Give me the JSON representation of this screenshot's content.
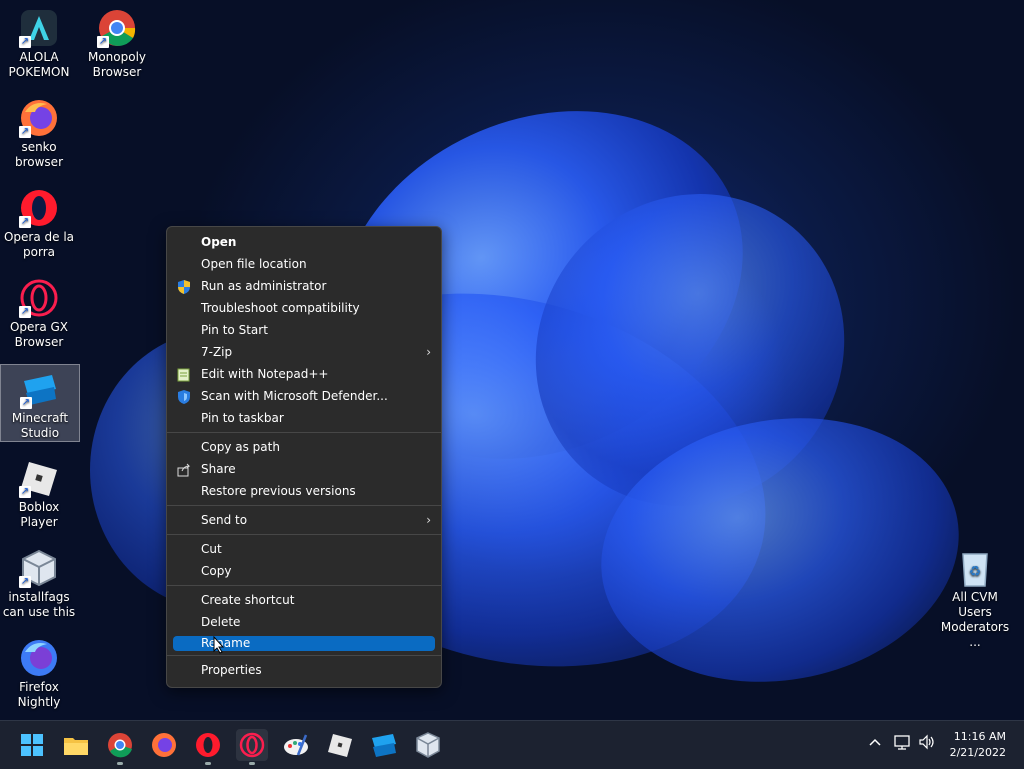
{
  "desktop_icons": [
    {
      "label": "ALOLA\nPOKEMON"
    },
    {
      "label": "Monopoly\nBrowser"
    },
    {
      "label": "senko\nbrowser"
    },
    {
      "label": "Opera de la\nporra"
    },
    {
      "label": "Opera GX\nBrowser"
    },
    {
      "label": "Minecraft\nStudio"
    },
    {
      "label": "Boblox Player"
    },
    {
      "label": "installfags\ncan use this"
    },
    {
      "label": "Firefox\nNightly"
    },
    {
      "label": "All CVM Users\nModerators ..."
    }
  ],
  "context_menu": {
    "items": [
      {
        "label": "Open"
      },
      {
        "label": "Open file location"
      },
      {
        "label": "Run as administrator",
        "icon": "shield-icon"
      },
      {
        "label": "Troubleshoot compatibility"
      },
      {
        "label": "Pin to Start"
      },
      {
        "label": "7-Zip",
        "submenu": true
      },
      {
        "label": "Edit with Notepad++",
        "icon": "notepad-icon"
      },
      {
        "label": "Scan with Microsoft Defender...",
        "icon": "defender-icon"
      },
      {
        "label": "Pin to taskbar"
      },
      {
        "label": "Copy as path"
      },
      {
        "label": "Share",
        "icon": "share-icon"
      },
      {
        "label": "Restore previous versions"
      },
      {
        "label": "Send to",
        "submenu": true
      },
      {
        "label": "Cut"
      },
      {
        "label": "Copy"
      },
      {
        "label": "Create shortcut"
      },
      {
        "label": "Delete"
      },
      {
        "label": "Rename"
      },
      {
        "label": "Properties"
      }
    ],
    "submenu_glyph": "›"
  },
  "taskbar": {
    "apps": [
      "start-icon",
      "file-explorer-icon",
      "chrome-icon",
      "firefox-icon",
      "opera-icon",
      "opera-gx-icon",
      "paint-icon",
      "roblox-icon",
      "minecraft-studio-icon",
      "virtualbox-icon"
    ],
    "tray_chevron": "^",
    "clock": {
      "time": "11:16 AM",
      "date": "2/21/2022"
    }
  },
  "colors": {
    "accent": "#0a6bc2",
    "menu_bg": "#2b2b2b",
    "taskbar_bg": "#1c2230"
  }
}
